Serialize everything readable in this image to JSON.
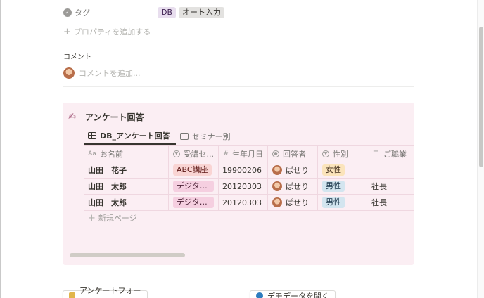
{
  "property": {
    "name": "タグ",
    "tags": [
      "DB",
      "オート入力"
    ]
  },
  "add_property_label": "プロパティを追加する",
  "comments": {
    "title": "コメント",
    "placeholder": "コメントを追加..."
  },
  "callout": {
    "title": "アンケート回答",
    "tabs": [
      {
        "label": "DB_アンケート回答",
        "active": true
      },
      {
        "label": "セミナー別",
        "active": false
      }
    ],
    "columns": [
      {
        "label": "お名前",
        "icon": "Aa"
      },
      {
        "label": "受講セ...",
        "icon": "select"
      },
      {
        "label": "生年月日",
        "icon": "#"
      },
      {
        "label": "回答者",
        "icon": "person"
      },
      {
        "label": "性別",
        "icon": "select"
      },
      {
        "label": "ご職業",
        "icon": "text"
      }
    ],
    "rows": [
      {
        "name": "山田　花子",
        "course": "ABC講座",
        "course_color": "red",
        "birth": "19900206",
        "respondent": "ぱせり",
        "gender": "女性",
        "gender_color": "yellow",
        "job": ""
      },
      {
        "name": "山田　太郎",
        "course": "デジタル...",
        "course_color": "pink",
        "birth": "20120303",
        "respondent": "ぱせり",
        "gender": "男性",
        "gender_color": "blue",
        "job": "社長"
      },
      {
        "name": "山田　太郎",
        "course": "デジタル...",
        "course_color": "pink",
        "birth": "20120303",
        "respondent": "ぱせり",
        "gender": "男性",
        "gender_color": "blue",
        "job": "社長"
      }
    ],
    "new_page_label": "新規ページ"
  },
  "bottom_buttons": [
    {
      "label": "アンケートフォーム"
    },
    {
      "label": "デモデータを開く"
    }
  ],
  "colors": {
    "callout_bg": "#fbeef3",
    "tag_purple": "#e8deee",
    "tag_gray": "#e3e2e0"
  }
}
